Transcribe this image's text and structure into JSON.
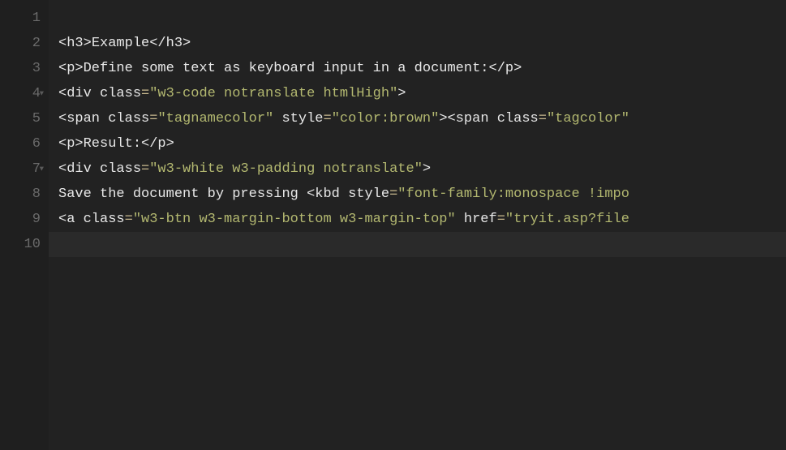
{
  "gutter": {
    "lines": [
      "1",
      "2",
      "3",
      "4",
      "5",
      "6",
      "7",
      "8",
      "9",
      "10"
    ]
  },
  "foldable": [
    4,
    7
  ],
  "code": {
    "l1": "",
    "l2": {
      "t1": "<h3>",
      "txt": "Example",
      "t2": "</h3>"
    },
    "l3": {
      "t1": "<p>",
      "txt": "Define some text as keyboard input in a document:",
      "t2": "</p>"
    },
    "l4": {
      "t1": "<div",
      "attr1": " class",
      "eq1": "=",
      "val1": "\"w3-code notranslate htmlHigh\"",
      "t2": ">"
    },
    "l5": {
      "t1": "<span",
      "attr1": " class",
      "eq1": "=",
      "val1": "\"tagnamecolor\"",
      "attr2": " style",
      "eq2": "=",
      "val2": "\"color:brown\"",
      "t2": "><span",
      "attr3": " class",
      "eq3": "=",
      "val3": "\"tagcolor\""
    },
    "l6": {
      "t1": "<p>",
      "txt": "Result:",
      "t2": "</p>"
    },
    "l7": {
      "t1": "<div",
      "attr1": " class",
      "eq1": "=",
      "val1": "\"w3-white w3-padding notranslate\"",
      "t2": ">"
    },
    "l8": {
      "txt1": "Save the document by pressing ",
      "t1": "<kbd",
      "attr1": " style",
      "eq1": "=",
      "val1": "\"font-family:monospace !impo"
    },
    "l9": {
      "t1": "<a",
      "attr1": " class",
      "eq1": "=",
      "val1": "\"w3-btn w3-margin-bottom w3-margin-top\"",
      "attr2": " href",
      "eq2": "=",
      "val2": "\"tryit.asp?file"
    },
    "l10": ""
  }
}
